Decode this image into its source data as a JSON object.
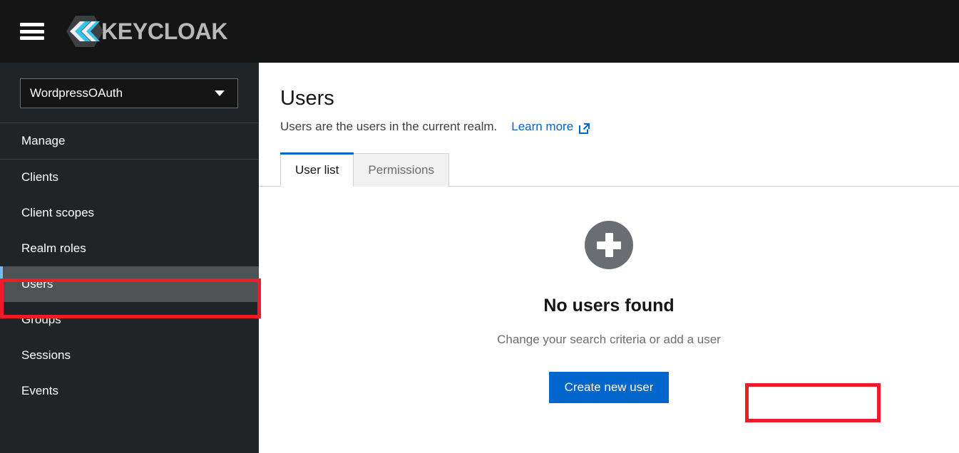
{
  "masthead": {
    "menu_toggle_name": "Global navigation",
    "brand_name": "KEYCLOAK",
    "brand_icon": "keycloak-hexagon-logo"
  },
  "sidebar": {
    "realm_selector": {
      "value": "WordpressOAuth",
      "caret_icon": "chevron-down-icon"
    },
    "group_title": "Manage",
    "items": [
      {
        "label": "Clients",
        "current": false
      },
      {
        "label": "Client scopes",
        "current": false
      },
      {
        "label": "Realm roles",
        "current": false
      },
      {
        "label": "Users",
        "current": true
      },
      {
        "label": "Groups",
        "current": false
      },
      {
        "label": "Sessions",
        "current": false
      },
      {
        "label": "Events",
        "current": false
      }
    ]
  },
  "main": {
    "title": "Users",
    "subtitle": "Users are the users in the current realm.",
    "learn_more_label": "Learn more",
    "learn_more_icon": "external-link-icon",
    "tabs": [
      {
        "label": "User list",
        "active": true
      },
      {
        "label": "Permissions",
        "active": false
      }
    ],
    "empty_state": {
      "icon": "plus-circle-icon",
      "title": "No users found",
      "body": "Change your search criteria or add a user",
      "action_label": "Create new user"
    }
  },
  "annotations": {
    "color": "#ED1C2A",
    "targets": [
      "sidebar-item-users",
      "create-new-user-button"
    ]
  },
  "colors": {
    "masthead_bg": "#151515",
    "sidebar_bg": "#212427",
    "nav_current_bg": "#4F5255",
    "nav_current_accent": "#73BCF7",
    "primary_blue": "#0066CC",
    "link_blue": "#0066CC",
    "empty_icon_gray": "#6A6E73",
    "annotation_red": "#ED1C2A"
  }
}
